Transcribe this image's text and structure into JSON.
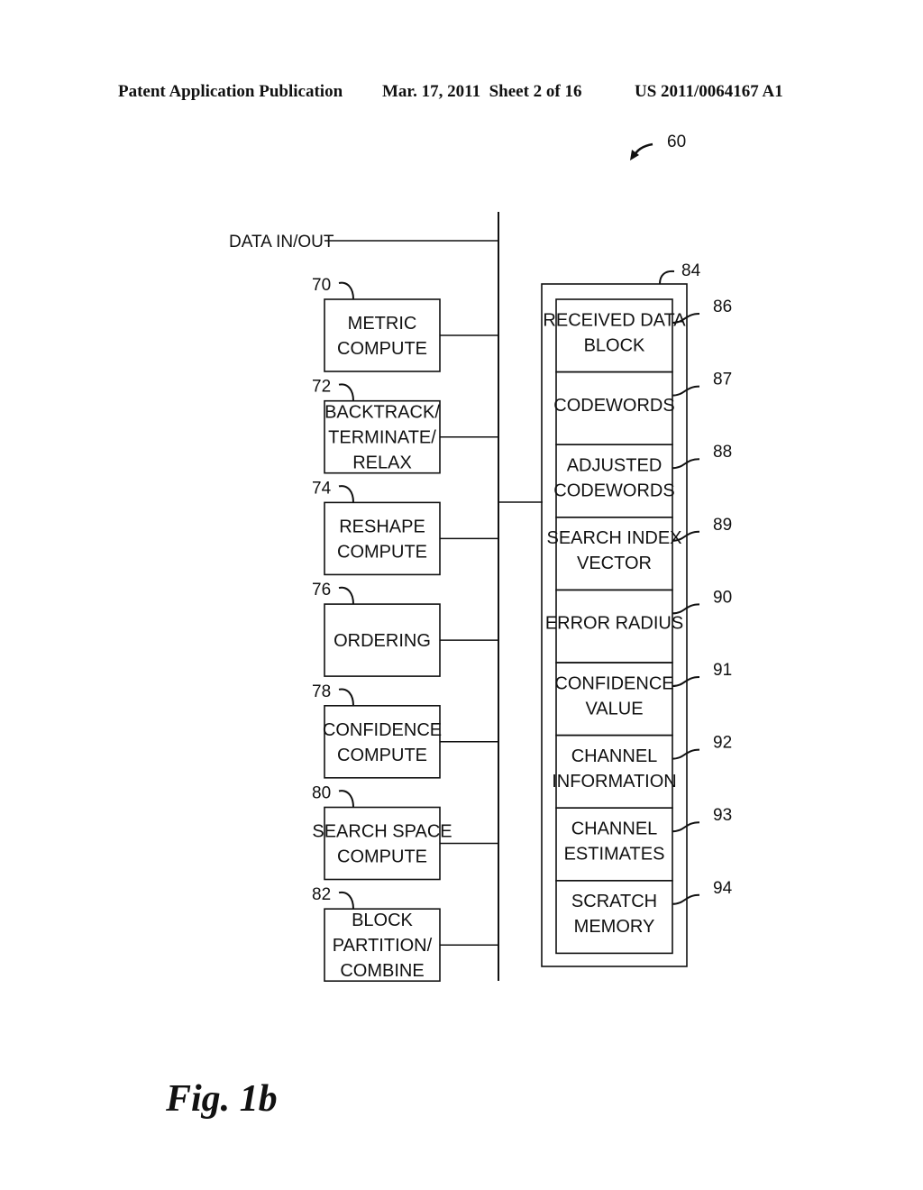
{
  "header": {
    "publication": "Patent Application Publication",
    "date_sheet": "Mar. 17, 2011  Sheet 2 of 16",
    "patent_number": "US 2011/0064167 A1"
  },
  "figure": {
    "reference": "60",
    "caption": "Fig. 1b"
  },
  "bus": {
    "data_label": "DATA IN/OUT"
  },
  "left_blocks": [
    {
      "ref": "70",
      "lines": [
        "METRIC",
        "COMPUTE"
      ]
    },
    {
      "ref": "72",
      "lines": [
        "BACKTRACK/",
        "TERMINATE/",
        "RELAX"
      ]
    },
    {
      "ref": "74",
      "lines": [
        "RESHAPE",
        "COMPUTE"
      ]
    },
    {
      "ref": "76",
      "lines": [
        "ORDERING"
      ]
    },
    {
      "ref": "78",
      "lines": [
        "CONFIDENCE",
        "COMPUTE"
      ]
    },
    {
      "ref": "80",
      "lines": [
        "SEARCH SPACE",
        "COMPUTE"
      ]
    },
    {
      "ref": "82",
      "lines": [
        "BLOCK",
        "PARTITION/",
        "COMBINE"
      ]
    }
  ],
  "memory": {
    "ref": "84",
    "cells": [
      {
        "ref": "86",
        "lines": [
          "RECEIVED DATA",
          "BLOCK"
        ]
      },
      {
        "ref": "87",
        "lines": [
          "CODEWORDS"
        ]
      },
      {
        "ref": "88",
        "lines": [
          "ADJUSTED",
          "CODEWORDS"
        ]
      },
      {
        "ref": "89",
        "lines": [
          "SEARCH INDEX",
          "VECTOR"
        ]
      },
      {
        "ref": "90",
        "lines": [
          "ERROR RADIUS"
        ]
      },
      {
        "ref": "91",
        "lines": [
          "CONFIDENCE",
          "VALUE"
        ]
      },
      {
        "ref": "92",
        "lines": [
          "CHANNEL",
          "INFORMATION"
        ]
      },
      {
        "ref": "93",
        "lines": [
          "CHANNEL",
          "ESTIMATES"
        ]
      },
      {
        "ref": "94",
        "lines": [
          "SCRATCH",
          "MEMORY"
        ]
      }
    ]
  }
}
